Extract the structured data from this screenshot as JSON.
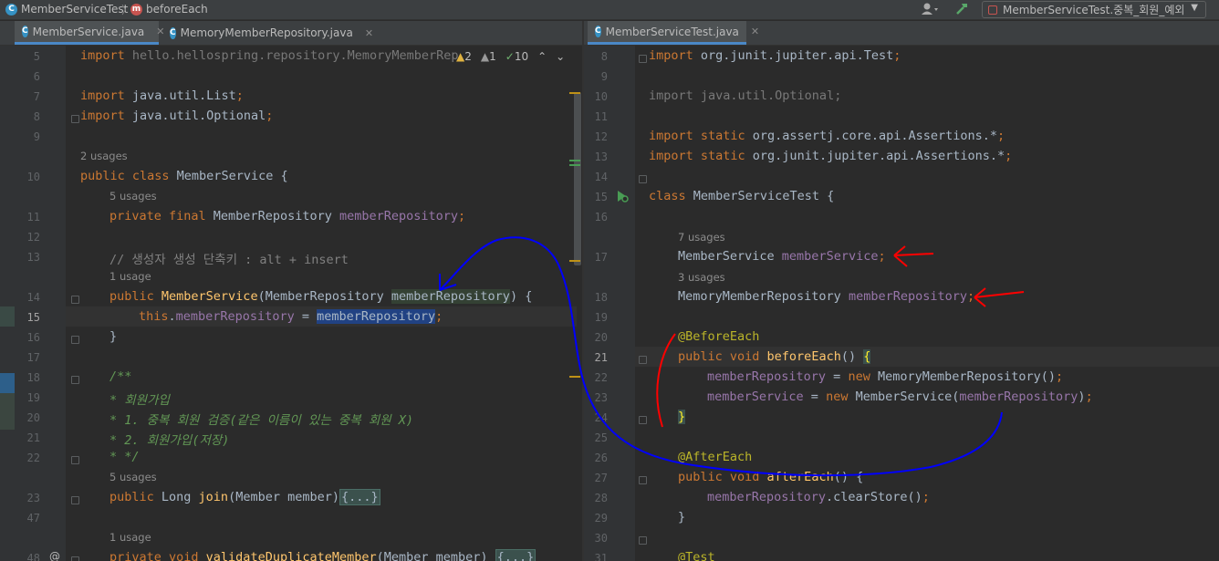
{
  "navbar": {
    "breadcrumb_class": "MemberServiceTest",
    "breadcrumb_method": "beforeEach",
    "run_config": "MemberServiceTest.중복_회원_예외"
  },
  "left": {
    "tabs": [
      {
        "label": "MemberService.java",
        "active": true
      },
      {
        "label": "MemoryMemberRepository.java",
        "active": false
      }
    ],
    "inspections": {
      "warnings": "2",
      "weak": "1",
      "ok": "10"
    },
    "lines": [
      {
        "n": "5",
        "text": "import hello.hellospring.repository.MemoryMemberRep"
      },
      {
        "n": "6",
        "text": ""
      },
      {
        "n": "7",
        "text": "import java.util.List;"
      },
      {
        "n": "8",
        "text": "import java.util.Optional;"
      },
      {
        "n": "9",
        "text": ""
      },
      {
        "n": "10",
        "text": "public class MemberService {"
      },
      {
        "n": "11",
        "text": "private final MemberRepository memberRepository;"
      },
      {
        "n": "12",
        "text": ""
      },
      {
        "n": "13",
        "text": "// 생성자 생성 단축키 : alt + insert"
      },
      {
        "n": "14",
        "text": "public MemberService(MemberRepository memberRepository) {"
      },
      {
        "n": "15",
        "text": "this.memberRepository = memberRepository;"
      },
      {
        "n": "16",
        "text": "}"
      },
      {
        "n": "17",
        "text": ""
      },
      {
        "n": "18",
        "text": "/**"
      },
      {
        "n": "19",
        "text": "* 회원가입"
      },
      {
        "n": "20",
        "text": "* 1. 중복 회원 검증(같은 이름이 있는 중복 회원 X)"
      },
      {
        "n": "21",
        "text": "* 2. 회원가입(저장)"
      },
      {
        "n": "22",
        "text": "* */"
      },
      {
        "n": "23",
        "text": "public Long join(Member member){...}"
      },
      {
        "n": "47",
        "text": ""
      },
      {
        "n": "48",
        "text": "private void validateDuplicateMember(Member member) {...}"
      }
    ],
    "usages": {
      "class": "2 usages",
      "field": "5 usages",
      "ctor": "1 usage",
      "join": "5 usages",
      "validate": "1 usage"
    }
  },
  "right": {
    "tabs": [
      {
        "label": "MemberServiceTest.java",
        "active": true
      }
    ],
    "lines": [
      {
        "n": "8",
        "text": "import org.junit.jupiter.api.Test;"
      },
      {
        "n": "9",
        "text": ""
      },
      {
        "n": "10",
        "text": "import java.util.Optional;"
      },
      {
        "n": "11",
        "text": ""
      },
      {
        "n": "12",
        "text": "import static org.assertj.core.api.Assertions.*;"
      },
      {
        "n": "13",
        "text": "import static org.junit.jupiter.api.Assertions.*;"
      },
      {
        "n": "14",
        "text": ""
      },
      {
        "n": "15",
        "text": "class MemberServiceTest {"
      },
      {
        "n": "16",
        "text": ""
      },
      {
        "n": "17",
        "text": "MemberService memberService;"
      },
      {
        "n": "18",
        "text": "MemoryMemberRepository memberRepository;"
      },
      {
        "n": "19",
        "text": ""
      },
      {
        "n": "20",
        "text": "@BeforeEach"
      },
      {
        "n": "21",
        "text": "public void beforeEach() {"
      },
      {
        "n": "22",
        "text": "memberRepository = new MemoryMemberRepository();"
      },
      {
        "n": "23",
        "text": "memberService = new MemberService(memberRepository);"
      },
      {
        "n": "24",
        "text": "}"
      },
      {
        "n": "25",
        "text": ""
      },
      {
        "n": "26",
        "text": "@AfterEach"
      },
      {
        "n": "27",
        "text": "public void afterEach() {"
      },
      {
        "n": "28",
        "text": "memberRepository.clearStore();"
      },
      {
        "n": "29",
        "text": "}"
      },
      {
        "n": "30",
        "text": ""
      },
      {
        "n": "31",
        "text": "@Test"
      }
    ],
    "usages": {
      "memberService": "7 usages",
      "memberRepository": "3 usages"
    }
  },
  "annotation_colors": {
    "blue": "#0000ff",
    "red": "#ff0000"
  }
}
